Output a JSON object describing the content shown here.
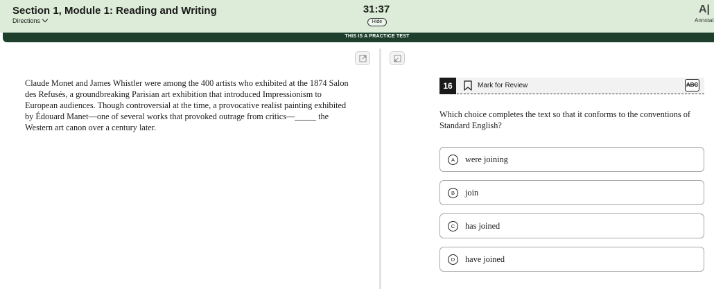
{
  "header": {
    "section_title": "Section 1, Module 1: Reading and Writing",
    "directions_label": "Directions",
    "timer": "31:37",
    "hide_label": "Hide",
    "annotate_label": "Annotat"
  },
  "banner": {
    "text": "THIS IS A PRACTICE TEST"
  },
  "passage": {
    "text": "Claude Monet and James Whistler were among the 400 artists who exhibited at the 1874 Salon des Refusés, a groundbreaking Parisian art exhibition that introduced Impressionism to European audiences. Though controversial at the time, a provocative realist painting exhibited by Édouard Manet—one of several works that provoked outrage from critics—_____ the Western art canon over a century later."
  },
  "question": {
    "number": "16",
    "mark_for_review_label": "Mark for Review",
    "eliminator_label": "ABC",
    "prompt": "Which choice completes the text so that it conforms to the conventions of Standard English?",
    "choices": [
      {
        "letter": "A",
        "text": "were joining"
      },
      {
        "letter": "B",
        "text": "join"
      },
      {
        "letter": "C",
        "text": "has joined"
      },
      {
        "letter": "D",
        "text": "have joined"
      }
    ]
  },
  "colors": {
    "header_bg": "#dcecd8",
    "banner_bg": "#1d3f2c",
    "question_number_bg": "#1a1a1a"
  }
}
